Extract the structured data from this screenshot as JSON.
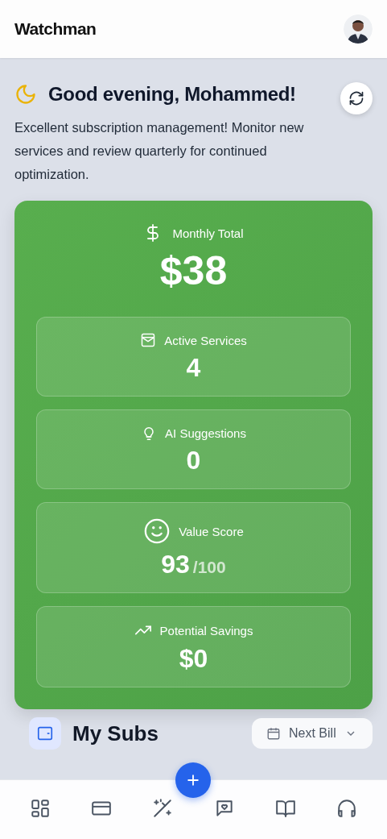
{
  "app_bar": {
    "title": "Watchman"
  },
  "greeting": {
    "title": "Good evening, Mohammed!",
    "message": "Excellent subscription management! Monitor new services and review quarterly for continued optimization."
  },
  "summary": {
    "label": "Monthly Total",
    "value": "$38",
    "stats": [
      {
        "label": "Active Services",
        "value": "4"
      },
      {
        "label": "AI Suggestions",
        "value": "0"
      },
      {
        "label": "Value Score",
        "value": "93",
        "suffix": "/100"
      },
      {
        "label": "Potential Savings",
        "value": "$0"
      }
    ]
  },
  "subscriptions_header": {
    "title": "My Subs",
    "sort": "Next Bill"
  }
}
